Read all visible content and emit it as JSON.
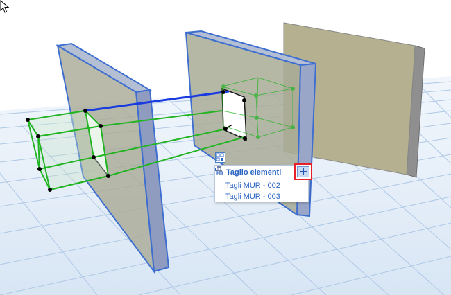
{
  "popup": {
    "title": "Taglio elementi",
    "items": [
      {
        "label": "Tagli MUR - 002"
      },
      {
        "label": "Tagli MUR - 003"
      }
    ],
    "add_button_symbol": "+"
  },
  "icons": {
    "popup_toggle": "cut-elements-icon",
    "header": "tree-icon",
    "pin": "pin-icon",
    "add": "plus-icon",
    "cursor": "mouse-cursor-icon"
  },
  "colors": {
    "selection_blue": "#2f6fd8",
    "cut_body_green": "#22b422",
    "wall_tan": "#b5b190",
    "grid_line": "#aec8e6",
    "highlight_red": "#e8202a",
    "menu_text": "#2b64c1"
  }
}
